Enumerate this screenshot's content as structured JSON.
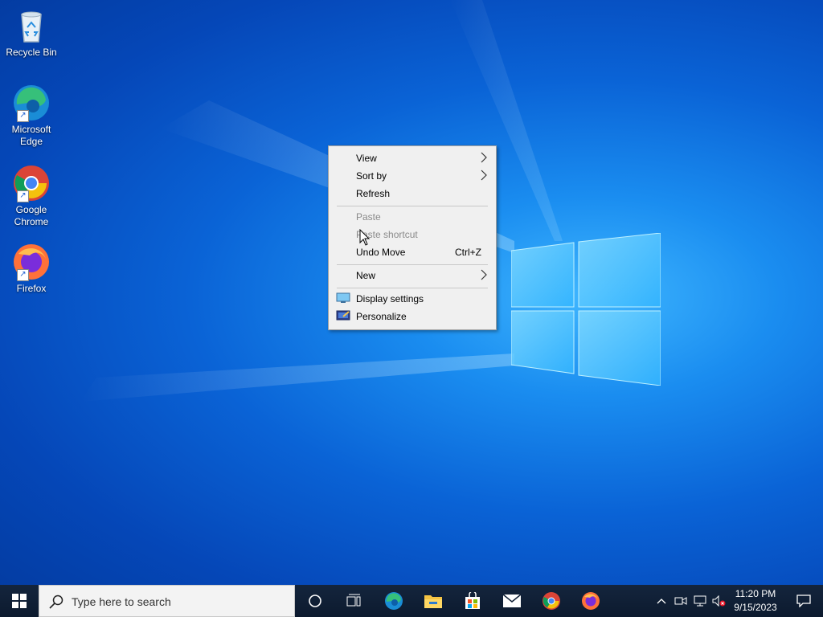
{
  "desktop": {
    "icons": [
      {
        "label": "Recycle Bin",
        "icon": "recycle-bin-icon"
      },
      {
        "label": "Microsoft Edge",
        "icon": "edge-icon"
      },
      {
        "label": "Google Chrome",
        "icon": "chrome-icon"
      },
      {
        "label": "Firefox",
        "icon": "firefox-icon"
      }
    ]
  },
  "context_menu": {
    "items": [
      {
        "label": "View",
        "submenu": true,
        "enabled": true
      },
      {
        "label": "Sort by",
        "submenu": true,
        "enabled": true
      },
      {
        "label": "Refresh",
        "enabled": true
      },
      {
        "label": "Paste",
        "enabled": false
      },
      {
        "label": "Paste shortcut",
        "enabled": false
      },
      {
        "label": "Undo Move",
        "shortcut": "Ctrl+Z",
        "enabled": true
      },
      {
        "label": "New",
        "submenu": true,
        "enabled": true
      },
      {
        "label": "Display settings",
        "icon": "display-icon",
        "enabled": true
      },
      {
        "label": "Personalize",
        "icon": "personalize-icon",
        "enabled": true
      }
    ]
  },
  "taskbar": {
    "search_placeholder": "Type here to search",
    "pinned": [
      "cortana-icon",
      "task-view-icon",
      "edge-icon",
      "file-explorer-icon",
      "store-icon",
      "mail-icon",
      "chrome-icon",
      "firefox-icon"
    ],
    "tray": [
      "chevron-up-icon",
      "meet-now-icon",
      "network-icon",
      "volume-muted-icon"
    ],
    "clock": {
      "time": "11:20 PM",
      "date": "9/15/2023"
    },
    "notification": "action-center-icon"
  },
  "colors": {
    "accent": "#0078d7",
    "taskbar_bg": "#0f1f35",
    "menu_bg": "#f0f0f0"
  }
}
